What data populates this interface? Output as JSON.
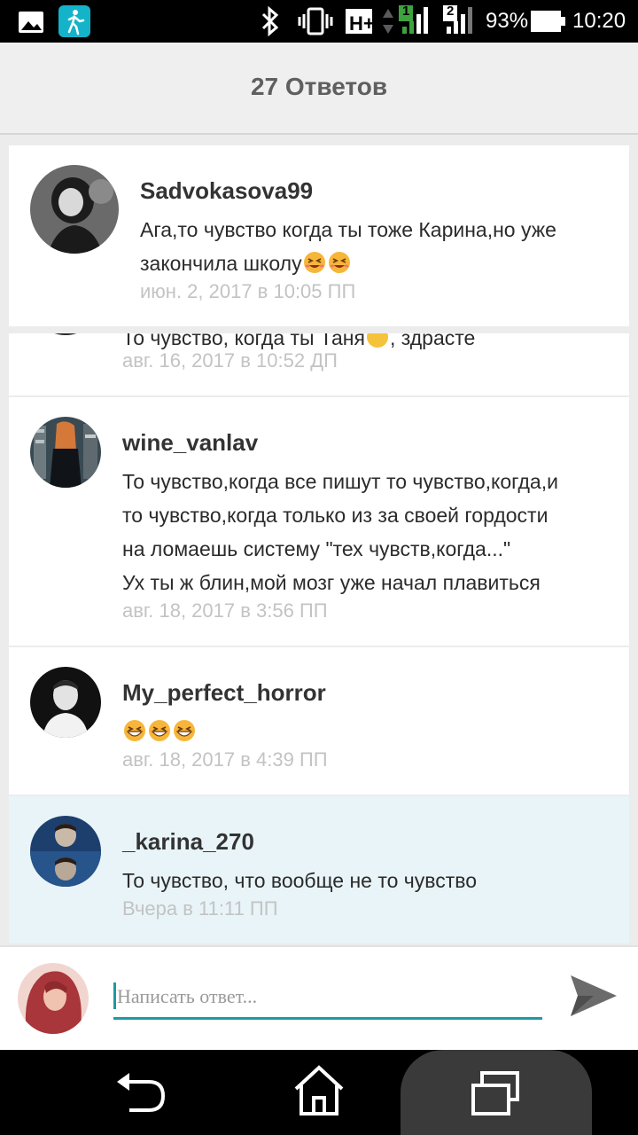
{
  "status_bar": {
    "network_type": "H+",
    "sim1": "1",
    "sim2": "2",
    "battery": "93%",
    "time": "10:20",
    "icons": [
      "gallery-icon",
      "fitness-app-icon",
      "bluetooth-icon",
      "vibrate-icon",
      "signal-icon",
      "battery-icon"
    ]
  },
  "header": {
    "title": "27 Ответов"
  },
  "pinned_comment": {
    "username": "Sadvokasova99",
    "text": "Ага,то чувство когда ты тоже Карина,но уже закончила школу",
    "emojis": 2,
    "time": "июн. 2, 2017 в 10:05 ПП"
  },
  "comments": [
    {
      "username": "",
      "text": "То чувство, когда ты Таня",
      "text_tail": ", здрасте",
      "time": "авг. 16, 2017 в 10:52 ДП",
      "partially_hidden": true
    },
    {
      "username": "wine_vanlav",
      "lines": [
        "То чувство,когда все пишут то чувство,когда,и",
        "то чувство,когда только из за своей гордости",
        "на ломаешь систему \"тех чувств,когда...\"",
        "Ух ты ж блин,мой мозг уже начал плавиться"
      ],
      "time": "авг. 18, 2017 в 3:56 ПП"
    },
    {
      "username": "My_perfect_horror",
      "emojis": 3,
      "time": "авг. 18, 2017 в 4:39 ПП"
    },
    {
      "username": "_karina_270",
      "text": "То чувство, что вообще не то чувство",
      "time": "Вчера в 11:11 ПП",
      "highlighted": true
    }
  ],
  "reply": {
    "placeholder": "Написать ответ..."
  },
  "nav": {
    "icons": [
      "back-icon",
      "home-icon",
      "recent-apps-icon"
    ]
  },
  "colors": {
    "accent": "#1e9aa4",
    "highlight": "#e8f4f8",
    "timestamp": "#c3c3c3"
  }
}
